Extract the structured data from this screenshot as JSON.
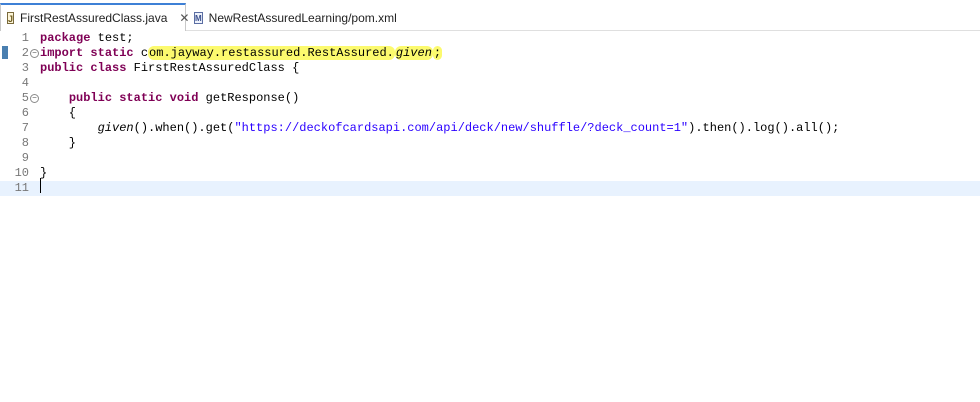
{
  "tabs": [
    {
      "label": "FirstRestAssuredClass.java",
      "icon": "java-file-icon",
      "active": true
    },
    {
      "label": "NewRestAssuredLearning/pom.xml",
      "icon": "maven-pom-icon",
      "active": false
    }
  ],
  "editor": {
    "highlight_color": "#fcfa6e",
    "current_line": 11,
    "lines": [
      {
        "n": "1",
        "parts": [
          {
            "t": "package",
            "c": "kw"
          },
          {
            "t": " test;",
            "c": ""
          }
        ]
      },
      {
        "n": "2",
        "fold": true,
        "parts": [
          {
            "t": "import",
            "c": "kw"
          },
          {
            "t": " ",
            "c": ""
          },
          {
            "t": "static",
            "c": "kw"
          },
          {
            "t": " c",
            "c": ""
          },
          {
            "t": "om.jayway.restassured.RestAssured.",
            "c": "hl"
          },
          {
            "t": "given",
            "c": "hl it"
          },
          {
            "t": ";",
            "c": "hl"
          }
        ]
      },
      {
        "n": "3",
        "parts": [
          {
            "t": "public",
            "c": "kw"
          },
          {
            "t": " ",
            "c": ""
          },
          {
            "t": "class",
            "c": "kw"
          },
          {
            "t": " FirstRestAssuredClass {",
            "c": ""
          }
        ]
      },
      {
        "n": "4",
        "parts": []
      },
      {
        "n": "5",
        "fold": true,
        "parts": [
          {
            "t": "    ",
            "c": ""
          },
          {
            "t": "public",
            "c": "kw"
          },
          {
            "t": " ",
            "c": ""
          },
          {
            "t": "static",
            "c": "kw"
          },
          {
            "t": " ",
            "c": ""
          },
          {
            "t": "void",
            "c": "kw"
          },
          {
            "t": " getResponse()",
            "c": ""
          }
        ]
      },
      {
        "n": "6",
        "parts": [
          {
            "t": "    {",
            "c": ""
          }
        ]
      },
      {
        "n": "7",
        "parts": [
          {
            "t": "        ",
            "c": ""
          },
          {
            "t": "given",
            "c": "it"
          },
          {
            "t": "().when().get(",
            "c": ""
          },
          {
            "t": "\"https://deckofcardsapi.com/api/deck/new/shuffle/?deck_count=1\"",
            "c": "str"
          },
          {
            "t": ").then().log().all();",
            "c": ""
          }
        ]
      },
      {
        "n": "8",
        "parts": [
          {
            "t": "    }",
            "c": ""
          }
        ]
      },
      {
        "n": "9",
        "parts": []
      },
      {
        "n": "10",
        "parts": [
          {
            "t": "}",
            "c": ""
          }
        ]
      },
      {
        "n": "11",
        "parts": []
      }
    ]
  }
}
